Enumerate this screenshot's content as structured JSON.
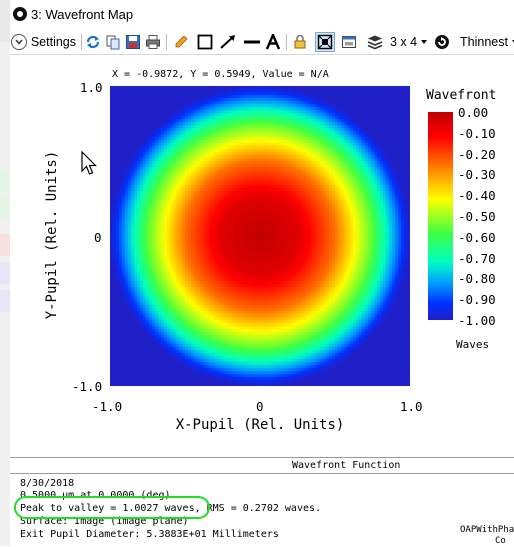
{
  "window": {
    "title": "3: Wavefront Map"
  },
  "toolbar": {
    "settings_label": "Settings",
    "layout_label": "3 x 4",
    "line_label": "Thinnest"
  },
  "plot": {
    "coord_readout": "X = -0.9872, Y = 0.5949, Value = N/A",
    "y_ticks": [
      "1.0",
      "0",
      "-1.0"
    ],
    "x_ticks": [
      "-1.0",
      "0",
      "1.0"
    ],
    "xlabel": "X-Pupil (Rel. Units)",
    "ylabel": "Y-Pupil (Rel. Units)",
    "legend_title": "Wavefront",
    "colorbar_labels": [
      "0.00",
      "-0.10",
      "-0.20",
      "-0.30",
      "-0.40",
      "-0.50",
      "-0.60",
      "-0.70",
      "-0.80",
      "-0.90",
      "-1.00"
    ],
    "units": "Waves",
    "colors": {
      "outside": "#2020c8",
      "highlight": "#22dd22"
    }
  },
  "chart_data": {
    "type": "heatmap",
    "title": "",
    "xlabel": "X-Pupil (Rel. Units)",
    "ylabel": "Y-Pupil (Rel. Units)",
    "xlim": [
      -1.0,
      1.0
    ],
    "ylim": [
      -1.0,
      1.0
    ],
    "colorbar_range": [
      -1.0,
      0.0
    ],
    "colorbar_label": "Waves",
    "model": "defocus wavefront: value = 0.00 at pupil center falling radially to -1.00 at the pupil edge",
    "radial_profile": {
      "r": [
        0.0,
        0.25,
        0.5,
        0.75,
        1.0
      ],
      "value": [
        0.0,
        -0.06,
        -0.25,
        -0.56,
        -1.0
      ]
    },
    "peak_to_valley_waves": 1.0027,
    "rms_waves": 0.2702
  },
  "panel": {
    "title": "Wavefront Function",
    "lines": [
      "8/30/2018",
      "0.5000 µm at 0.0000 (deg)",
      "Peak to valley = 1.0027 waves, RMS = 0.2702 waves.",
      "Surface: Image (image plane)",
      "Exit Pupil Diameter: 5.3883E+01 Millimeters"
    ],
    "right_text_1": "OAPWithPha",
    "right_text_2": "Co"
  }
}
